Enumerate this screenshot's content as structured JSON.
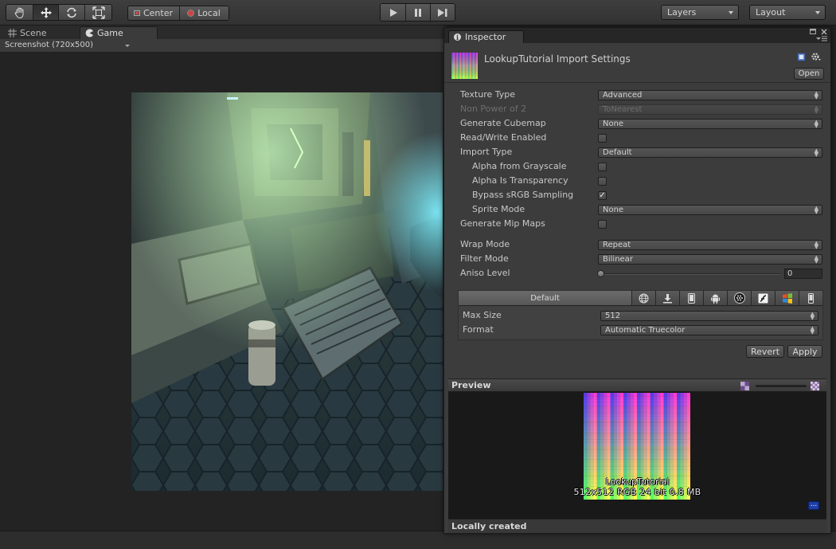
{
  "toolbar": {
    "tools": [
      "hand-tool",
      "move-tool",
      "rotate-tool",
      "scale-tool"
    ],
    "pivot_label": "Center",
    "space_label": "Local",
    "layers_label": "Layers",
    "layout_label": "Layout"
  },
  "views": {
    "scene_tab": "Scene",
    "game_tab": "Game",
    "resolution": "Screenshot (720x500)"
  },
  "inspector": {
    "tab_label": "Inspector",
    "title": "LookupTutorial Import Settings",
    "open_button": "Open",
    "properties": {
      "texture_type": {
        "label": "Texture Type",
        "value": "Advanced"
      },
      "non_power_of_2": {
        "label": "Non Power of 2",
        "value": "ToNearest"
      },
      "generate_cubemap": {
        "label": "Generate Cubemap",
        "value": "None"
      },
      "read_write": {
        "label": "Read/Write Enabled",
        "checked": false
      },
      "import_type": {
        "label": "Import Type",
        "value": "Default"
      },
      "alpha_from_grayscale": {
        "label": "Alpha from Grayscale",
        "checked": false
      },
      "alpha_is_transparency": {
        "label": "Alpha Is Transparency",
        "checked": false
      },
      "bypass_srgb": {
        "label": "Bypass sRGB Sampling",
        "checked": true,
        "mark": "✓"
      },
      "sprite_mode": {
        "label": "Sprite Mode",
        "value": "None"
      },
      "generate_mip_maps": {
        "label": "Generate Mip Maps",
        "checked": false
      },
      "wrap_mode": {
        "label": "Wrap Mode",
        "value": "Repeat"
      },
      "filter_mode": {
        "label": "Filter Mode",
        "value": "Bilinear"
      },
      "aniso_level": {
        "label": "Aniso Level",
        "value": "0"
      }
    },
    "platform": {
      "default_tab": "Default",
      "icons": [
        "web-player-icon",
        "standalone-download-icon",
        "ios-icon",
        "android-icon",
        "blackberry-icon",
        "flash-icon",
        "windows-store-icon",
        "windows-phone-icon"
      ],
      "max_size": {
        "label": "Max Size",
        "value": "512"
      },
      "format": {
        "label": "Format",
        "value": "Automatic Truecolor"
      }
    },
    "revert_button": "Revert",
    "apply_button": "Apply",
    "preview": {
      "title": "Preview",
      "name": "LookupTutorial",
      "info": "512x512  RGB 24 bit   0.8 MB"
    },
    "footer": "Locally created"
  },
  "colors": {
    "accent_blue": "#1e3ea8",
    "panel": "#3c3c3c",
    "toolbar": "#3a3a3a"
  }
}
